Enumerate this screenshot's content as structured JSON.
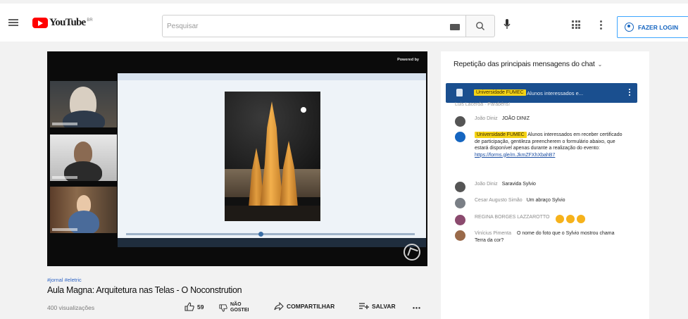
{
  "header": {
    "logo_text": "YouTube",
    "logo_country": "BR",
    "search_placeholder": "Pesquisar",
    "login_label": "FAZER LOGIN"
  },
  "player": {
    "powered_by": "Powered by"
  },
  "video": {
    "hashtag": "#jornal #eletric",
    "title": "Aula Magna: Arquitetura nas Telas - O Noconstrution",
    "views": "400 visualizações",
    "like_count": "59",
    "dislike_label_1": "NÃO",
    "dislike_label_2": "GOSTEI",
    "share_label": "COMPARTILHAR",
    "save_label": "SALVAR"
  },
  "chat": {
    "header": "Repetição das principais mensagens do chat",
    "pinned": {
      "author": "Universidade FUMEC",
      "text": "Alunos interessados e..."
    },
    "partial_line": "Luis Lacerda · Parabéns!",
    "messages": [
      {
        "author": "João Diniz",
        "text": "JOÃO DINIZ"
      },
      {
        "author": "Universidade FUMEC",
        "text": "Alunos interessados em receber certificado de participação, gentileza preencherem o formulário abaixo, que estará disponível apenas durante a realização do evento:",
        "link": "https://forms.gle/m.JkmZFXhXbahB7"
      },
      {
        "author": "João Diniz",
        "text": "Saravida Sylvio"
      },
      {
        "author": "Cesar Augusto Simão",
        "text": "Um abraço Sylvio"
      },
      {
        "author": "REGINA BORGES LAZZAROTTO",
        "text": ""
      },
      {
        "author": "Vinícius Pimenta",
        "text": "O nome do foto que o Sylvio mostrou chama Terra da cor?"
      }
    ]
  },
  "colors": {
    "youtube_red": "#ff0000",
    "pinned_bg": "#1a4f8f",
    "tag_yellow": "#f5d316",
    "login_blue": "#3ea6ff"
  }
}
